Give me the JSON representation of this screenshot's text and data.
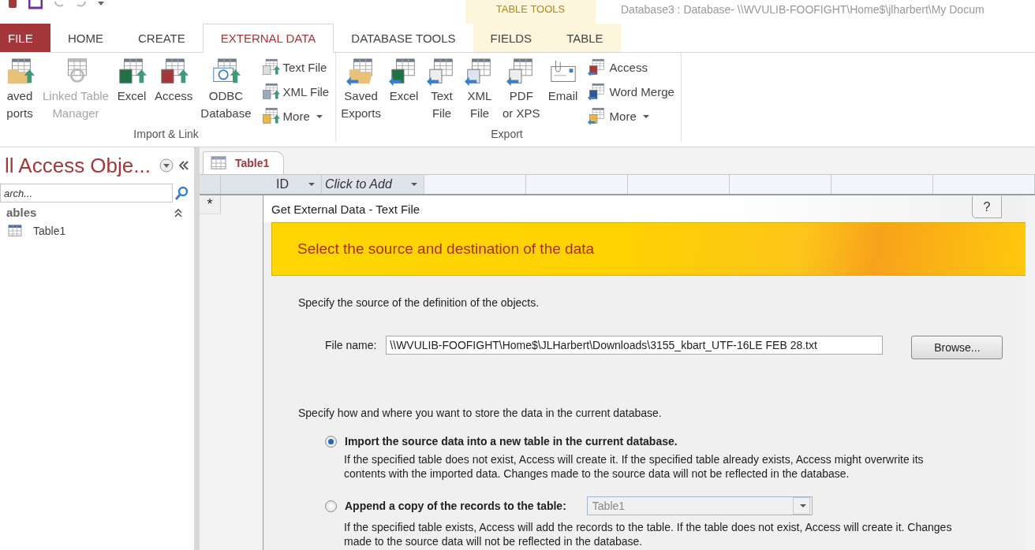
{
  "window": {
    "title": "Database3 : Database- \\\\WVULIB-FOOFIGHT\\Home$\\jlharbert\\My Docum",
    "context_label": "TABLE TOOLS"
  },
  "tabs": [
    {
      "label": "FILE",
      "kind": "file",
      "selected": false
    },
    {
      "label": "HOME",
      "kind": "plain",
      "selected": false
    },
    {
      "label": "CREATE",
      "kind": "plain",
      "selected": false
    },
    {
      "label": "EXTERNAL DATA",
      "kind": "plain",
      "selected": true
    },
    {
      "label": "DATABASE TOOLS",
      "kind": "plain",
      "selected": false
    },
    {
      "label": "FIELDS",
      "kind": "contextual",
      "selected": false
    },
    {
      "label": "TABLE",
      "kind": "contextual",
      "selected": false
    }
  ],
  "ribbon_groups": [
    {
      "label": "Import & Link",
      "large_buttons": [
        {
          "lines": [
            "aved",
            "ports"
          ],
          "disabled": false
        },
        {
          "lines": [
            "Linked Table",
            "Manager"
          ],
          "disabled": true
        },
        {
          "lines": [
            "Excel"
          ],
          "disabled": false
        },
        {
          "lines": [
            "Access"
          ],
          "disabled": false
        },
        {
          "lines": [
            "ODBC",
            "Database"
          ],
          "disabled": false
        }
      ],
      "small_buttons": [
        {
          "label": "Text File",
          "dropdown": false
        },
        {
          "label": "XML File",
          "dropdown": false
        },
        {
          "label": "More",
          "dropdown": true
        }
      ]
    },
    {
      "label": "Export",
      "large_buttons": [
        {
          "lines": [
            "Saved",
            "Exports"
          ],
          "disabled": false
        },
        {
          "lines": [
            "Excel"
          ],
          "disabled": false
        },
        {
          "lines": [
            "Text",
            "File"
          ],
          "disabled": false
        },
        {
          "lines": [
            "XML",
            "File"
          ],
          "disabled": false
        },
        {
          "lines": [
            "PDF",
            "or XPS"
          ],
          "disabled": false
        },
        {
          "lines": [
            "Email"
          ],
          "disabled": false
        }
      ],
      "small_buttons": [
        {
          "label": "Access",
          "dropdown": false
        },
        {
          "label": "Word Merge",
          "dropdown": false
        },
        {
          "label": "More",
          "dropdown": true
        }
      ]
    }
  ],
  "navigation": {
    "title": "ll Access Obje...",
    "search_placeholder": "arch...",
    "groups": [
      {
        "label": "ables",
        "expanded": true,
        "items": [
          {
            "label": "Table1",
            "selected": false
          }
        ]
      }
    ]
  },
  "document": {
    "tabs": [
      {
        "label": "Table1",
        "selected": true
      }
    ],
    "columns": [
      {
        "label": "ID",
        "kind": "field"
      },
      {
        "label": "Click to Add",
        "kind": "add"
      }
    ],
    "new_row_marker": "*"
  },
  "dialog": {
    "title": "Get External Data - Text File",
    "help": "?",
    "banner": "Select the source and destination of the data",
    "source_prompt": "Specify the source of the definition of the objects.",
    "file_label": "File name:",
    "file_value": "\\\\WVULIB-FOOFIGHT\\Home$\\JLHarbert\\Downloads\\3155_kbart_UTF-16LE FEB 28.txt",
    "browse": "Browse...",
    "store_prompt": "Specify how and where you want to store the data in the current database.",
    "options": [
      {
        "kind": "plain",
        "label": "Import the source data into a new table in the current database.",
        "selected": true,
        "description": "If the specified table does not exist, Access will create it. If the specified table already exists, Access might overwrite its contents with the imported data. Changes made to the source data will not be reflected in the database."
      },
      {
        "kind": "with_table",
        "label": "Append a copy of the records to the table:",
        "selected": false,
        "table": {
          "value": "Table1",
          "disabled": true
        },
        "description": "If the specified table exists, Access will add the records to the table. If the table does not exist, Access will create it. Changes made to the source data will not be reflected in the database."
      }
    ]
  }
}
